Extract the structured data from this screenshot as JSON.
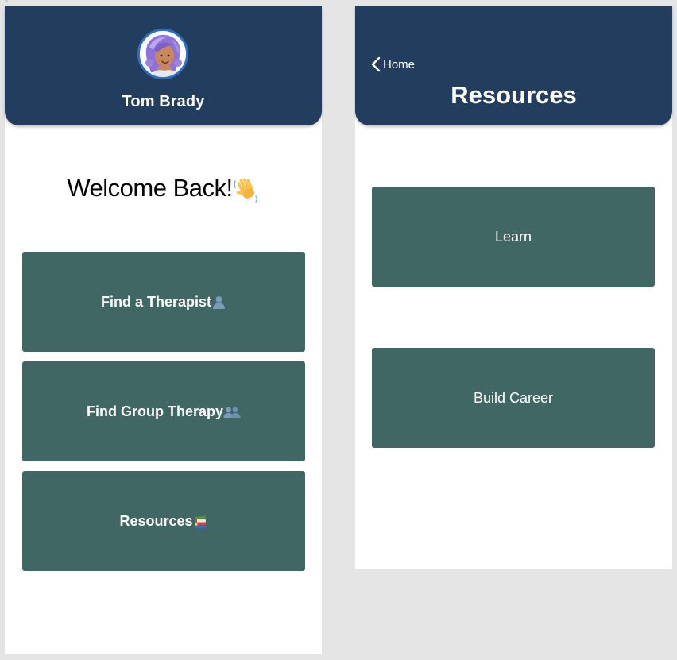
{
  "home_screen": {
    "profile": {
      "name": "Tom Brady",
      "avatar_icon": "avatar-illustration"
    },
    "welcome": {
      "text": "Welcome Back!",
      "emoji_icon": "waving-hand-icon"
    },
    "menu": [
      {
        "label": "Find a Therapist",
        "icon": "person-silhouette-icon"
      },
      {
        "label": "Find Group Therapy",
        "icon": "people-silhouette-icon"
      },
      {
        "label": "Resources",
        "icon": "books-icon"
      }
    ]
  },
  "resources_screen": {
    "back": {
      "label": "Home",
      "icon": "chevron-left-icon"
    },
    "title": "Resources",
    "items": [
      {
        "label": "Learn"
      },
      {
        "label": "Build Career"
      }
    ]
  },
  "colors": {
    "canvas": "#e5e5e5",
    "header": "#233d5e",
    "card": "#406763",
    "avatar_ring": "#2f6fc4",
    "text_light": "#ffffff",
    "text_dark": "#000000"
  }
}
